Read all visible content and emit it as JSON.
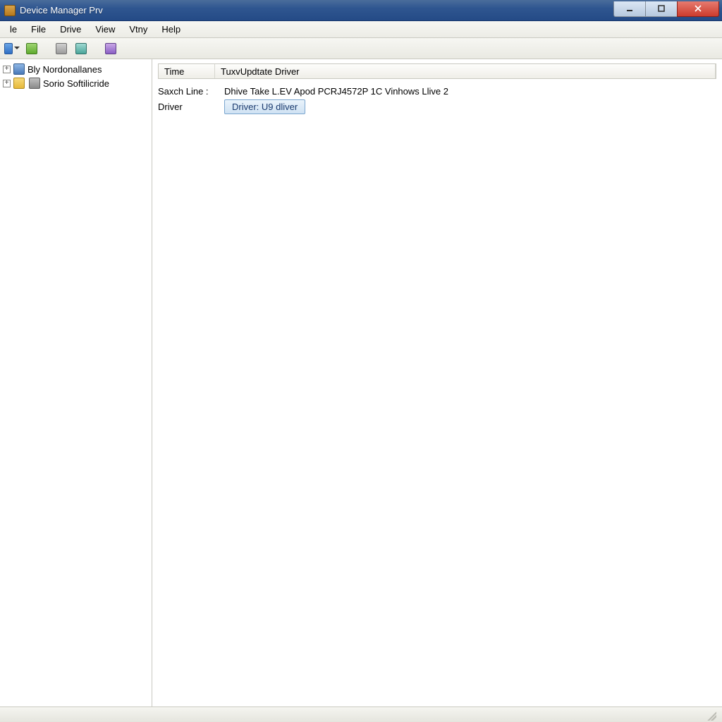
{
  "window": {
    "title": "Device Manager Prv"
  },
  "menu": {
    "items": [
      "le",
      "File",
      "Drive",
      "View",
      "Vtny",
      "Help"
    ]
  },
  "toolbar": {
    "buttons": [
      {
        "name": "toolbar-btn-1",
        "color": "blue",
        "dropdown": true
      },
      {
        "name": "toolbar-btn-2",
        "color": "green",
        "dropdown": false
      },
      {
        "name": "toolbar-sep-1",
        "sep": true
      },
      {
        "name": "toolbar-btn-3",
        "color": "grey",
        "dropdown": false
      },
      {
        "name": "toolbar-btn-4",
        "color": "teal",
        "dropdown": false
      },
      {
        "name": "toolbar-sep-2",
        "sep": true
      },
      {
        "name": "toolbar-btn-5",
        "color": "purple",
        "dropdown": false
      }
    ]
  },
  "tree": {
    "items": [
      {
        "icon": "monitor",
        "label": "Bly Nordonallanes"
      },
      {
        "icon_a": "folder",
        "icon_b": "disk",
        "label": "Sorio Softilicride"
      }
    ]
  },
  "list": {
    "columns": {
      "time": "Time",
      "text": "TuxvUpdtate Driver"
    }
  },
  "details": {
    "search_label": "Saxch Line :",
    "search_value": "Dhive Take L.EV Apod PCRJ4572P 1C Vinhows Llive   2",
    "driver_label": "Driver",
    "driver_button": "Driver: U9 dliver"
  },
  "status": {
    "left": "",
    "right": ""
  }
}
